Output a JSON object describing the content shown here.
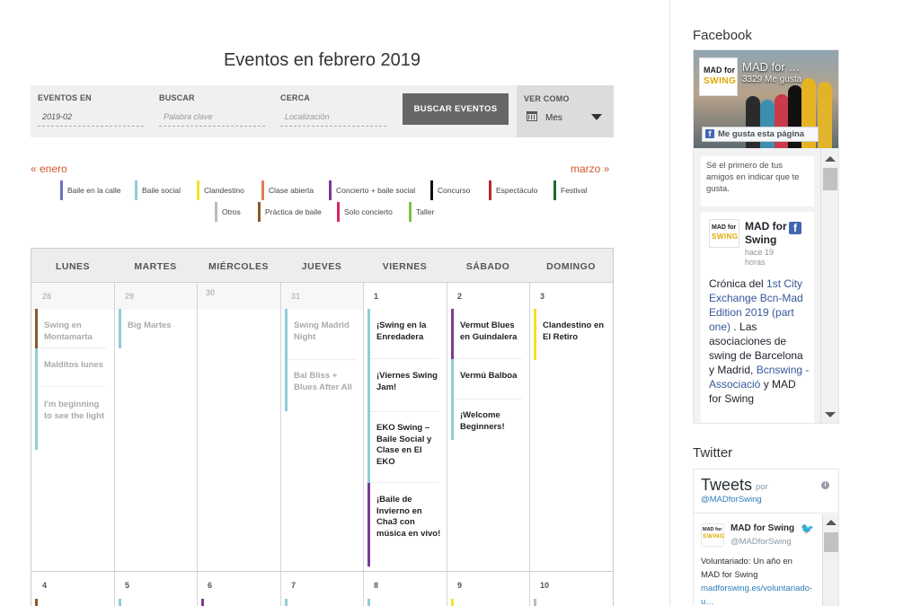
{
  "page_title": "Eventos en febrero 2019",
  "filters": {
    "eventos_en_label": "EVENTOS EN",
    "eventos_en_value": "2019-02",
    "buscar_label": "BUSCAR",
    "buscar_placeholder": "Palabra clave",
    "cerca_label": "CERCA",
    "cerca_placeholder": "Localización",
    "search_button": "BUSCAR EVENTOS",
    "ver_como_label": "VER COMO",
    "ver_como_value": "Mes"
  },
  "nav": {
    "prev": "« enero",
    "next": "marzo »"
  },
  "legend": [
    {
      "label": "Baile en la calle",
      "color": "#6b71c4"
    },
    {
      "label": "Baile social",
      "color": "#8ecdd8"
    },
    {
      "label": "Clandestino",
      "color": "#f2e425"
    },
    {
      "label": "Clase abierta",
      "color": "#e07c52"
    },
    {
      "label": "Concierto + baile social",
      "color": "#7b3a96"
    },
    {
      "label": "Concurso",
      "color": "#111111"
    },
    {
      "label": "Espectáculo",
      "color": "#b8282e"
    },
    {
      "label": "Festival",
      "color": "#1d6b2e"
    },
    {
      "label": "Otros",
      "color": "#bbbbbb"
    },
    {
      "label": "Práctica de baile",
      "color": "#8a5a2b"
    },
    {
      "label": "Solo concierto",
      "color": "#d62569"
    },
    {
      "label": "Taller",
      "color": "#7dc242"
    }
  ],
  "calendar": {
    "days": [
      "LUNES",
      "MARTES",
      "MIÉRCOLES",
      "JUEVES",
      "VIERNES",
      "SÁBADO",
      "DOMINGO"
    ],
    "week1": [
      "28",
      "29",
      "30",
      "31",
      "1",
      "2",
      "3"
    ],
    "week2": [
      "4",
      "5",
      "6",
      "7",
      "8",
      "9",
      "10"
    ],
    "events": {
      "mon": [
        "Swing en Montamarta",
        "Malditos lunes",
        "I'm beginning to see the light"
      ],
      "tue": [
        "Big Martes"
      ],
      "thu": [
        "Swing Madrid Night",
        "Bal Bliss + Blues After All"
      ],
      "fri": [
        "¡Swing en la Enredadera",
        "¡Viernes Swing Jam!",
        "EKO Swing – Baile Social y Clase en El EKO",
        "¡Baile de Invierno en Cha3 con música en vivo!"
      ],
      "sat": [
        "Vermut Blues en Guindalera",
        "Vermú Balboa",
        "¡Welcome Beginners!"
      ],
      "sun": [
        "Clandestino en El Retiro"
      ]
    }
  },
  "sidebar": {
    "facebook_title": "Facebook",
    "fb_page_name": "MAD for …",
    "fb_likes": "3329 Me gusta",
    "fb_like_button": "Me gusta esta página",
    "fb_first_like": "Sé el primero de tus amigos en indicar que te gusta.",
    "fb_post_name": "MAD for Swing",
    "fb_post_time": "hace 19 horas",
    "fb_post_text_1": "Crónica del ",
    "fb_post_link_1": "1st City Exchange Bcn-Mad Edition 2019 (part one)",
    "fb_post_text_2": " . Las asociaciones de swing de Barcelona y Madrid, ",
    "fb_post_link_2": "Bcnswing - Associació",
    "fb_post_text_3": " y MAD for Swing",
    "logo_line1": "MAD for",
    "logo_line2": "SWING",
    "twitter_title": "Twitter",
    "tw_heading": "Tweets",
    "tw_por": "por",
    "tw_handle": "@MADforSwing",
    "tw_name": "MAD for Swing",
    "tw_user": "@MADforSwing",
    "tw_text": "Voluntariado: Un año en MAD for Swing",
    "tw_link": "madforswing.es/voluntariado-u…"
  }
}
